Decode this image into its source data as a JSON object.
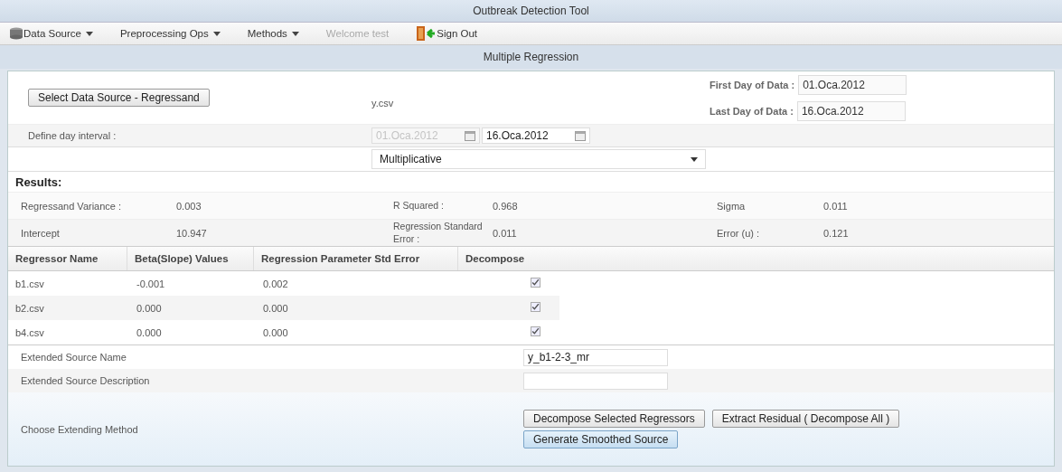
{
  "window": {
    "title": "Outbreak Detection Tool"
  },
  "menu": [
    {
      "label": "Data Source",
      "kind": "dropdown",
      "icon": true
    },
    {
      "label": "Preprocessing Ops",
      "kind": "dropdown",
      "icon": false
    },
    {
      "label": "Methods",
      "kind": "dropdown",
      "icon": false
    },
    {
      "label": "Welcome test",
      "kind": "text"
    },
    {
      "label": "Sign Out",
      "kind": "link",
      "icon": true
    }
  ],
  "panel": {
    "title": "Multiple Regression"
  },
  "source": {
    "button": "Select Data Source - Regressand",
    "file": "y.csv",
    "first_day_label": "First Day of Data :",
    "first_day": "01.Oca.2012",
    "last_day_label": "Last Day of Data :",
    "last_day": "16.Oca.2012"
  },
  "interval": {
    "label": "Define day interval :",
    "dates": [
      {
        "value": "01.Oca.2012",
        "disabled": true
      },
      {
        "value": "16.Oca.2012",
        "disabled": false
      }
    ]
  },
  "method_select": {
    "value": "Multiplicative"
  },
  "results": {
    "heading": "Results:",
    "rows": [
      [
        {
          "label": "Regressand Variance :",
          "value": "0.003"
        },
        {
          "label": "R Squared :",
          "value": "0.968"
        },
        {
          "label": "Sigma",
          "value": "0.011"
        }
      ],
      [
        {
          "label": "Intercept",
          "value": "10.947"
        },
        {
          "label": "Regression Standard Error :",
          "value": "0.011"
        },
        {
          "label": "Error (u) :",
          "value": "0.121"
        }
      ]
    ]
  },
  "regressors": {
    "columns": [
      "Regressor Name",
      "Beta(Slope) Values",
      "Regression Parameter Std Error",
      "Decompose"
    ],
    "rows": [
      {
        "name": "b1.csv",
        "beta": "-0.001",
        "std_error": "0.002",
        "decompose": true
      },
      {
        "name": "b2.csv",
        "beta": "0.000",
        "std_error": "0.000",
        "decompose": true
      },
      {
        "name": "b4.csv",
        "beta": "0.000",
        "std_error": "0.000",
        "decompose": true
      }
    ]
  },
  "extended": {
    "name_label": "Extended Source Name",
    "name_value": "y_b1-2-3_mr",
    "description_label": "Extended Source Description",
    "method_label": "Choose Extending Method",
    "buttons": [
      {
        "label": "Decompose Selected Regressors",
        "selected": false
      },
      {
        "label": "Extract Residual ( Decompose All )",
        "selected": false
      },
      {
        "label": "Generate Smoothed Source",
        "selected": true
      }
    ]
  }
}
